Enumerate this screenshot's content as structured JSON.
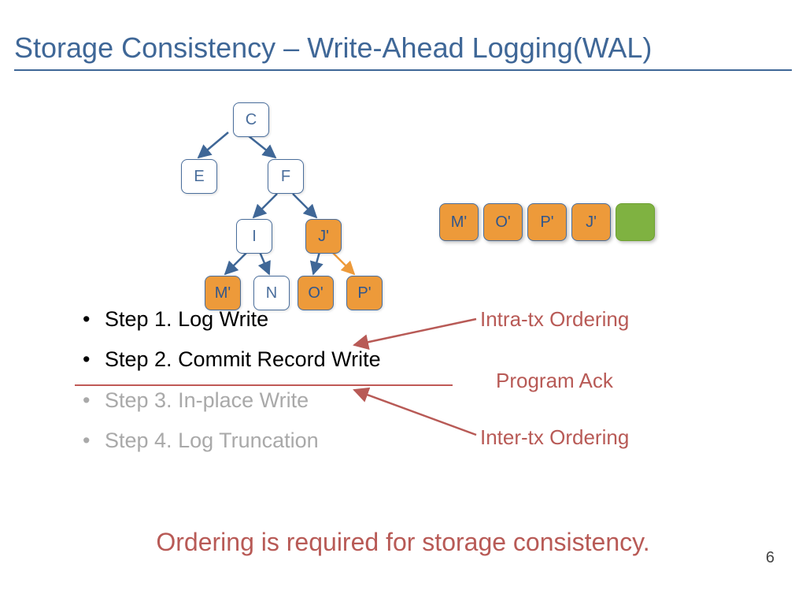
{
  "title": "Storage Consistency – Write-Ahead Logging(WAL)",
  "tree": {
    "C": "C",
    "E": "E",
    "F": "F",
    "I": "I",
    "Jp": "J'",
    "Mp": "M'",
    "N": "N",
    "Op": "O'",
    "Pp": "P'"
  },
  "log": {
    "Mp": "M'",
    "Op": "O'",
    "Pp": "P'",
    "Jp": "J'"
  },
  "steps": {
    "s1": "Step 1. Log Write",
    "s2": "Step 2. Commit Record Write",
    "s3": "Step 3. In-place Write",
    "s4": "Step 4. Log Truncation"
  },
  "annot": {
    "intra": "Intra-tx Ordering",
    "ack": "Program Ack",
    "inter": "Inter-tx Ordering"
  },
  "bottom": "Ordering is required for storage consistency.",
  "page": "6"
}
